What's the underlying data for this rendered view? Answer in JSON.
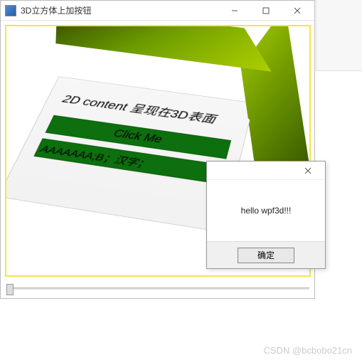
{
  "window": {
    "title": "3D立方体上加按钮"
  },
  "cube": {
    "content_label": "2D content 呈现在3D表面",
    "button_label": "Click Me",
    "textbox_value": "AAAAAAA;B；汉字；"
  },
  "dialog": {
    "message": "hello wpf3d!!!",
    "ok_label": "确定"
  },
  "watermark": "CSDN @bcbobo21cn"
}
